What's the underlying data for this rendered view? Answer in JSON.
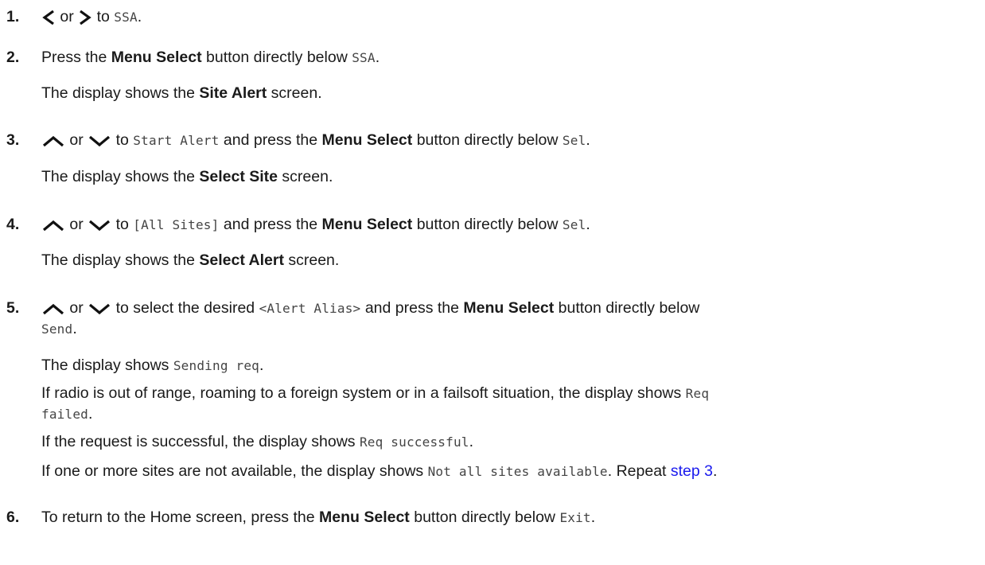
{
  "steps": [
    {
      "num": "1.",
      "or": "or",
      "to": "to",
      "code": "SSA",
      "end": "."
    },
    {
      "num": "2.",
      "pre": "Press the",
      "bold": "Menu Select",
      "mid": "button directly below",
      "code": "SSA",
      "end": ".",
      "result_pre": "The display shows the",
      "result_bold": "Site Alert",
      "result_post": "screen."
    },
    {
      "num": "3.",
      "or": "or",
      "to": "to",
      "code1": "Start Alert",
      "pre": "and press the",
      "bold": "Menu Select",
      "mid": "button directly below",
      "code2": "Sel",
      "end": ".",
      "result_pre": "The display shows the",
      "result_bold": "Select Site",
      "result_post": "screen."
    },
    {
      "num": "4.",
      "or": "or",
      "to": "to",
      "code1": "[All Sites]",
      "pre": "and press the",
      "bold": "Menu Select",
      "mid": "button directly below",
      "code2": "Sel",
      "end": ".",
      "result_pre": "The display shows the",
      "result_bold": "Select Alert",
      "result_post": "screen."
    },
    {
      "num": "5.",
      "or": "or",
      "to": "to select the desired",
      "code1": "<Alert Alias>",
      "pre": "and press the",
      "bold": "Menu Select",
      "mid": "button directly below",
      "code2": "Send",
      "end": ".",
      "r1_pre": "The display shows",
      "r1_code": "Sending req",
      "r1_end": ".",
      "r2_pre": "If radio is out of range, roaming to a foreign system or in a failsoft situation, the display shows",
      "r2_code1": "Req",
      "r2_code2": "failed",
      "r2_end": ".",
      "r3_pre": "If the request is successful, the display shows",
      "r3_code": "Req successful",
      "r3_end": ".",
      "r4_pre": "If one or more sites are not available, the display shows",
      "r4_code": "Not all sites available",
      "r4_mid": ". Repeat",
      "r4_link": "step 3",
      "r4_end": "."
    },
    {
      "num": "6.",
      "pre": "To return to the Home screen, press the",
      "bold": "Menu Select",
      "mid": "button directly below",
      "code": "Exit",
      "end": "."
    }
  ],
  "icons": {
    "left": "chevron-left-icon",
    "right": "chevron-right-icon",
    "up": "chevron-up-icon",
    "down": "chevron-down-icon"
  },
  "colors": {
    "link": "#1a1aee",
    "text": "#1a1a1a",
    "code": "#444444"
  }
}
